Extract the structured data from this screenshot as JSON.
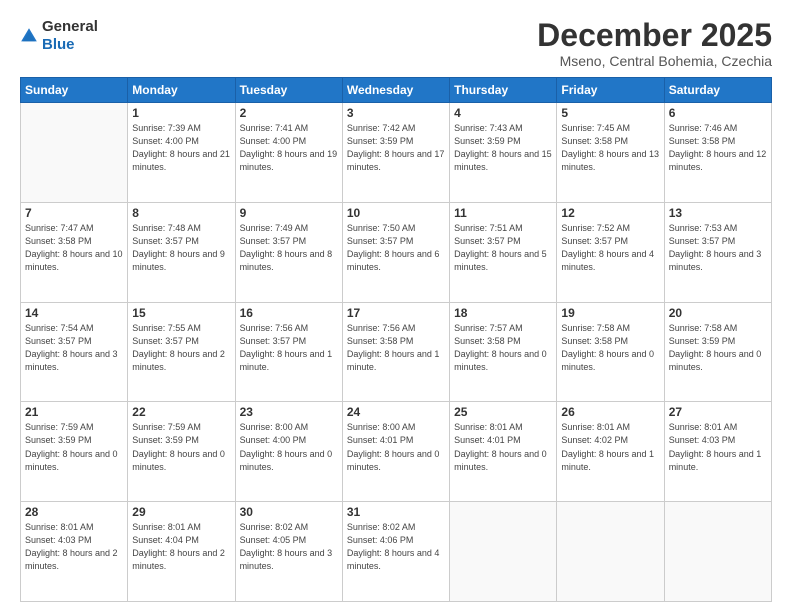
{
  "logo": {
    "general": "General",
    "blue": "Blue"
  },
  "title": "December 2025",
  "location": "Mseno, Central Bohemia, Czechia",
  "weekdays": [
    "Sunday",
    "Monday",
    "Tuesday",
    "Wednesday",
    "Thursday",
    "Friday",
    "Saturday"
  ],
  "weeks": [
    [
      {
        "day": "",
        "sunrise": "",
        "sunset": "",
        "daylight": ""
      },
      {
        "day": "1",
        "sunrise": "7:39 AM",
        "sunset": "4:00 PM",
        "daylight": "8 hours and 21 minutes."
      },
      {
        "day": "2",
        "sunrise": "7:41 AM",
        "sunset": "4:00 PM",
        "daylight": "8 hours and 19 minutes."
      },
      {
        "day": "3",
        "sunrise": "7:42 AM",
        "sunset": "3:59 PM",
        "daylight": "8 hours and 17 minutes."
      },
      {
        "day": "4",
        "sunrise": "7:43 AM",
        "sunset": "3:59 PM",
        "daylight": "8 hours and 15 minutes."
      },
      {
        "day": "5",
        "sunrise": "7:45 AM",
        "sunset": "3:58 PM",
        "daylight": "8 hours and 13 minutes."
      },
      {
        "day": "6",
        "sunrise": "7:46 AM",
        "sunset": "3:58 PM",
        "daylight": "8 hours and 12 minutes."
      }
    ],
    [
      {
        "day": "7",
        "sunrise": "7:47 AM",
        "sunset": "3:58 PM",
        "daylight": "8 hours and 10 minutes."
      },
      {
        "day": "8",
        "sunrise": "7:48 AM",
        "sunset": "3:57 PM",
        "daylight": "8 hours and 9 minutes."
      },
      {
        "day": "9",
        "sunrise": "7:49 AM",
        "sunset": "3:57 PM",
        "daylight": "8 hours and 8 minutes."
      },
      {
        "day": "10",
        "sunrise": "7:50 AM",
        "sunset": "3:57 PM",
        "daylight": "8 hours and 6 minutes."
      },
      {
        "day": "11",
        "sunrise": "7:51 AM",
        "sunset": "3:57 PM",
        "daylight": "8 hours and 5 minutes."
      },
      {
        "day": "12",
        "sunrise": "7:52 AM",
        "sunset": "3:57 PM",
        "daylight": "8 hours and 4 minutes."
      },
      {
        "day": "13",
        "sunrise": "7:53 AM",
        "sunset": "3:57 PM",
        "daylight": "8 hours and 3 minutes."
      }
    ],
    [
      {
        "day": "14",
        "sunrise": "7:54 AM",
        "sunset": "3:57 PM",
        "daylight": "8 hours and 3 minutes."
      },
      {
        "day": "15",
        "sunrise": "7:55 AM",
        "sunset": "3:57 PM",
        "daylight": "8 hours and 2 minutes."
      },
      {
        "day": "16",
        "sunrise": "7:56 AM",
        "sunset": "3:57 PM",
        "daylight": "8 hours and 1 minute."
      },
      {
        "day": "17",
        "sunrise": "7:56 AM",
        "sunset": "3:58 PM",
        "daylight": "8 hours and 1 minute."
      },
      {
        "day": "18",
        "sunrise": "7:57 AM",
        "sunset": "3:58 PM",
        "daylight": "8 hours and 0 minutes."
      },
      {
        "day": "19",
        "sunrise": "7:58 AM",
        "sunset": "3:58 PM",
        "daylight": "8 hours and 0 minutes."
      },
      {
        "day": "20",
        "sunrise": "7:58 AM",
        "sunset": "3:59 PM",
        "daylight": "8 hours and 0 minutes."
      }
    ],
    [
      {
        "day": "21",
        "sunrise": "7:59 AM",
        "sunset": "3:59 PM",
        "daylight": "8 hours and 0 minutes."
      },
      {
        "day": "22",
        "sunrise": "7:59 AM",
        "sunset": "3:59 PM",
        "daylight": "8 hours and 0 minutes."
      },
      {
        "day": "23",
        "sunrise": "8:00 AM",
        "sunset": "4:00 PM",
        "daylight": "8 hours and 0 minutes."
      },
      {
        "day": "24",
        "sunrise": "8:00 AM",
        "sunset": "4:01 PM",
        "daylight": "8 hours and 0 minutes."
      },
      {
        "day": "25",
        "sunrise": "8:01 AM",
        "sunset": "4:01 PM",
        "daylight": "8 hours and 0 minutes."
      },
      {
        "day": "26",
        "sunrise": "8:01 AM",
        "sunset": "4:02 PM",
        "daylight": "8 hours and 1 minute."
      },
      {
        "day": "27",
        "sunrise": "8:01 AM",
        "sunset": "4:03 PM",
        "daylight": "8 hours and 1 minute."
      }
    ],
    [
      {
        "day": "28",
        "sunrise": "8:01 AM",
        "sunset": "4:03 PM",
        "daylight": "8 hours and 2 minutes."
      },
      {
        "day": "29",
        "sunrise": "8:01 AM",
        "sunset": "4:04 PM",
        "daylight": "8 hours and 2 minutes."
      },
      {
        "day": "30",
        "sunrise": "8:02 AM",
        "sunset": "4:05 PM",
        "daylight": "8 hours and 3 minutes."
      },
      {
        "day": "31",
        "sunrise": "8:02 AM",
        "sunset": "4:06 PM",
        "daylight": "8 hours and 4 minutes."
      },
      {
        "day": "",
        "sunrise": "",
        "sunset": "",
        "daylight": ""
      },
      {
        "day": "",
        "sunrise": "",
        "sunset": "",
        "daylight": ""
      },
      {
        "day": "",
        "sunrise": "",
        "sunset": "",
        "daylight": ""
      }
    ]
  ],
  "labels": {
    "sunrise": "Sunrise:",
    "sunset": "Sunset:",
    "daylight": "Daylight:"
  }
}
